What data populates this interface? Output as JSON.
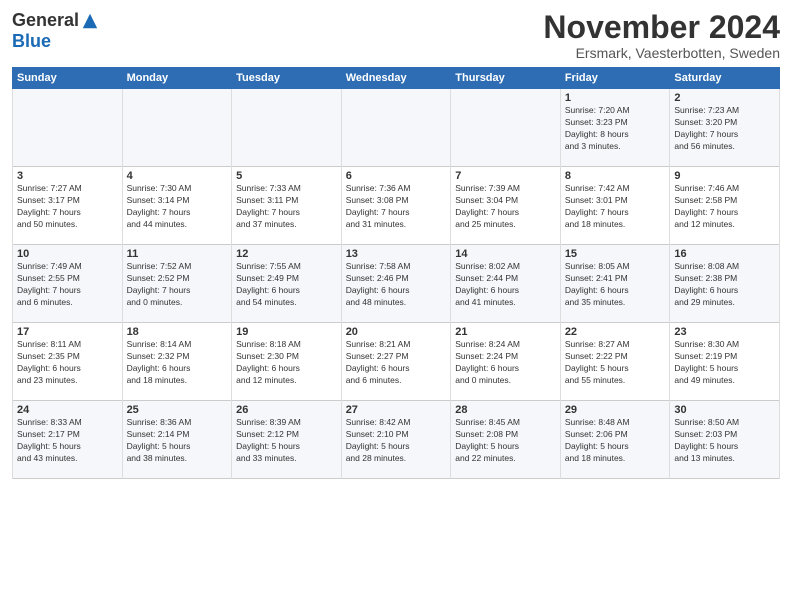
{
  "header": {
    "logo_general": "General",
    "logo_blue": "Blue",
    "month_title": "November 2024",
    "subtitle": "Ersmark, Vaesterbotten, Sweden"
  },
  "days_of_week": [
    "Sunday",
    "Monday",
    "Tuesday",
    "Wednesday",
    "Thursday",
    "Friday",
    "Saturday"
  ],
  "weeks": [
    [
      {
        "day": "",
        "info": ""
      },
      {
        "day": "",
        "info": ""
      },
      {
        "day": "",
        "info": ""
      },
      {
        "day": "",
        "info": ""
      },
      {
        "day": "",
        "info": ""
      },
      {
        "day": "1",
        "info": "Sunrise: 7:20 AM\nSunset: 3:23 PM\nDaylight: 8 hours\nand 3 minutes."
      },
      {
        "day": "2",
        "info": "Sunrise: 7:23 AM\nSunset: 3:20 PM\nDaylight: 7 hours\nand 56 minutes."
      }
    ],
    [
      {
        "day": "3",
        "info": "Sunrise: 7:27 AM\nSunset: 3:17 PM\nDaylight: 7 hours\nand 50 minutes."
      },
      {
        "day": "4",
        "info": "Sunrise: 7:30 AM\nSunset: 3:14 PM\nDaylight: 7 hours\nand 44 minutes."
      },
      {
        "day": "5",
        "info": "Sunrise: 7:33 AM\nSunset: 3:11 PM\nDaylight: 7 hours\nand 37 minutes."
      },
      {
        "day": "6",
        "info": "Sunrise: 7:36 AM\nSunset: 3:08 PM\nDaylight: 7 hours\nand 31 minutes."
      },
      {
        "day": "7",
        "info": "Sunrise: 7:39 AM\nSunset: 3:04 PM\nDaylight: 7 hours\nand 25 minutes."
      },
      {
        "day": "8",
        "info": "Sunrise: 7:42 AM\nSunset: 3:01 PM\nDaylight: 7 hours\nand 18 minutes."
      },
      {
        "day": "9",
        "info": "Sunrise: 7:46 AM\nSunset: 2:58 PM\nDaylight: 7 hours\nand 12 minutes."
      }
    ],
    [
      {
        "day": "10",
        "info": "Sunrise: 7:49 AM\nSunset: 2:55 PM\nDaylight: 7 hours\nand 6 minutes."
      },
      {
        "day": "11",
        "info": "Sunrise: 7:52 AM\nSunset: 2:52 PM\nDaylight: 7 hours\nand 0 minutes."
      },
      {
        "day": "12",
        "info": "Sunrise: 7:55 AM\nSunset: 2:49 PM\nDaylight: 6 hours\nand 54 minutes."
      },
      {
        "day": "13",
        "info": "Sunrise: 7:58 AM\nSunset: 2:46 PM\nDaylight: 6 hours\nand 48 minutes."
      },
      {
        "day": "14",
        "info": "Sunrise: 8:02 AM\nSunset: 2:44 PM\nDaylight: 6 hours\nand 41 minutes."
      },
      {
        "day": "15",
        "info": "Sunrise: 8:05 AM\nSunset: 2:41 PM\nDaylight: 6 hours\nand 35 minutes."
      },
      {
        "day": "16",
        "info": "Sunrise: 8:08 AM\nSunset: 2:38 PM\nDaylight: 6 hours\nand 29 minutes."
      }
    ],
    [
      {
        "day": "17",
        "info": "Sunrise: 8:11 AM\nSunset: 2:35 PM\nDaylight: 6 hours\nand 23 minutes."
      },
      {
        "day": "18",
        "info": "Sunrise: 8:14 AM\nSunset: 2:32 PM\nDaylight: 6 hours\nand 18 minutes."
      },
      {
        "day": "19",
        "info": "Sunrise: 8:18 AM\nSunset: 2:30 PM\nDaylight: 6 hours\nand 12 minutes."
      },
      {
        "day": "20",
        "info": "Sunrise: 8:21 AM\nSunset: 2:27 PM\nDaylight: 6 hours\nand 6 minutes."
      },
      {
        "day": "21",
        "info": "Sunrise: 8:24 AM\nSunset: 2:24 PM\nDaylight: 6 hours\nand 0 minutes."
      },
      {
        "day": "22",
        "info": "Sunrise: 8:27 AM\nSunset: 2:22 PM\nDaylight: 5 hours\nand 55 minutes."
      },
      {
        "day": "23",
        "info": "Sunrise: 8:30 AM\nSunset: 2:19 PM\nDaylight: 5 hours\nand 49 minutes."
      }
    ],
    [
      {
        "day": "24",
        "info": "Sunrise: 8:33 AM\nSunset: 2:17 PM\nDaylight: 5 hours\nand 43 minutes."
      },
      {
        "day": "25",
        "info": "Sunrise: 8:36 AM\nSunset: 2:14 PM\nDaylight: 5 hours\nand 38 minutes."
      },
      {
        "day": "26",
        "info": "Sunrise: 8:39 AM\nSunset: 2:12 PM\nDaylight: 5 hours\nand 33 minutes."
      },
      {
        "day": "27",
        "info": "Sunrise: 8:42 AM\nSunset: 2:10 PM\nDaylight: 5 hours\nand 28 minutes."
      },
      {
        "day": "28",
        "info": "Sunrise: 8:45 AM\nSunset: 2:08 PM\nDaylight: 5 hours\nand 22 minutes."
      },
      {
        "day": "29",
        "info": "Sunrise: 8:48 AM\nSunset: 2:06 PM\nDaylight: 5 hours\nand 18 minutes."
      },
      {
        "day": "30",
        "info": "Sunrise: 8:50 AM\nSunset: 2:03 PM\nDaylight: 5 hours\nand 13 minutes."
      }
    ]
  ]
}
